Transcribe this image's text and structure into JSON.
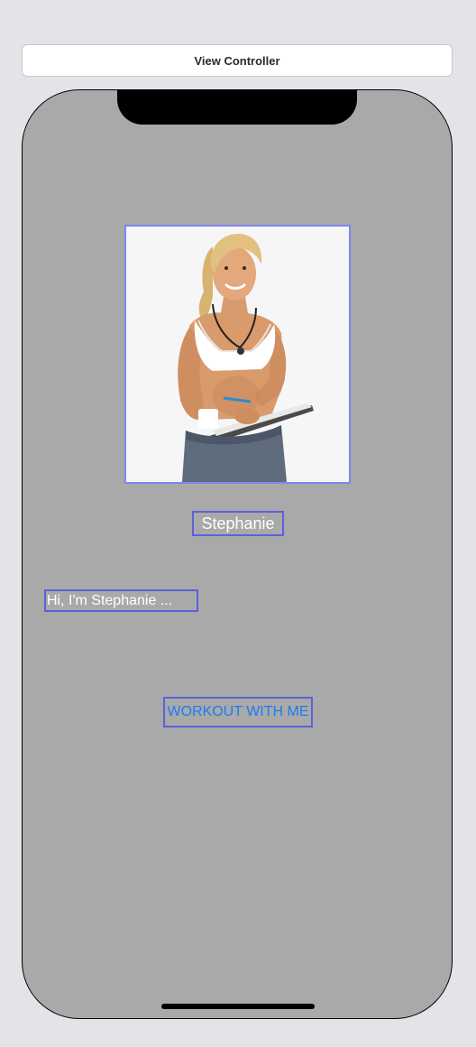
{
  "header": {
    "title": "View Controller"
  },
  "profile": {
    "image_description_icon": "trainer-photo",
    "name": "Stephanie",
    "intro": "Hi, I'm Stephanie ..."
  },
  "actions": {
    "workout_label": "WORKOUT WITH ME"
  },
  "colors": {
    "canvas_background": "#e3e4e8",
    "device_background": "#a9a9a9",
    "selection_border": "#5a62d8",
    "button_text": "#1a7cf5",
    "label_text": "#ffffff"
  }
}
